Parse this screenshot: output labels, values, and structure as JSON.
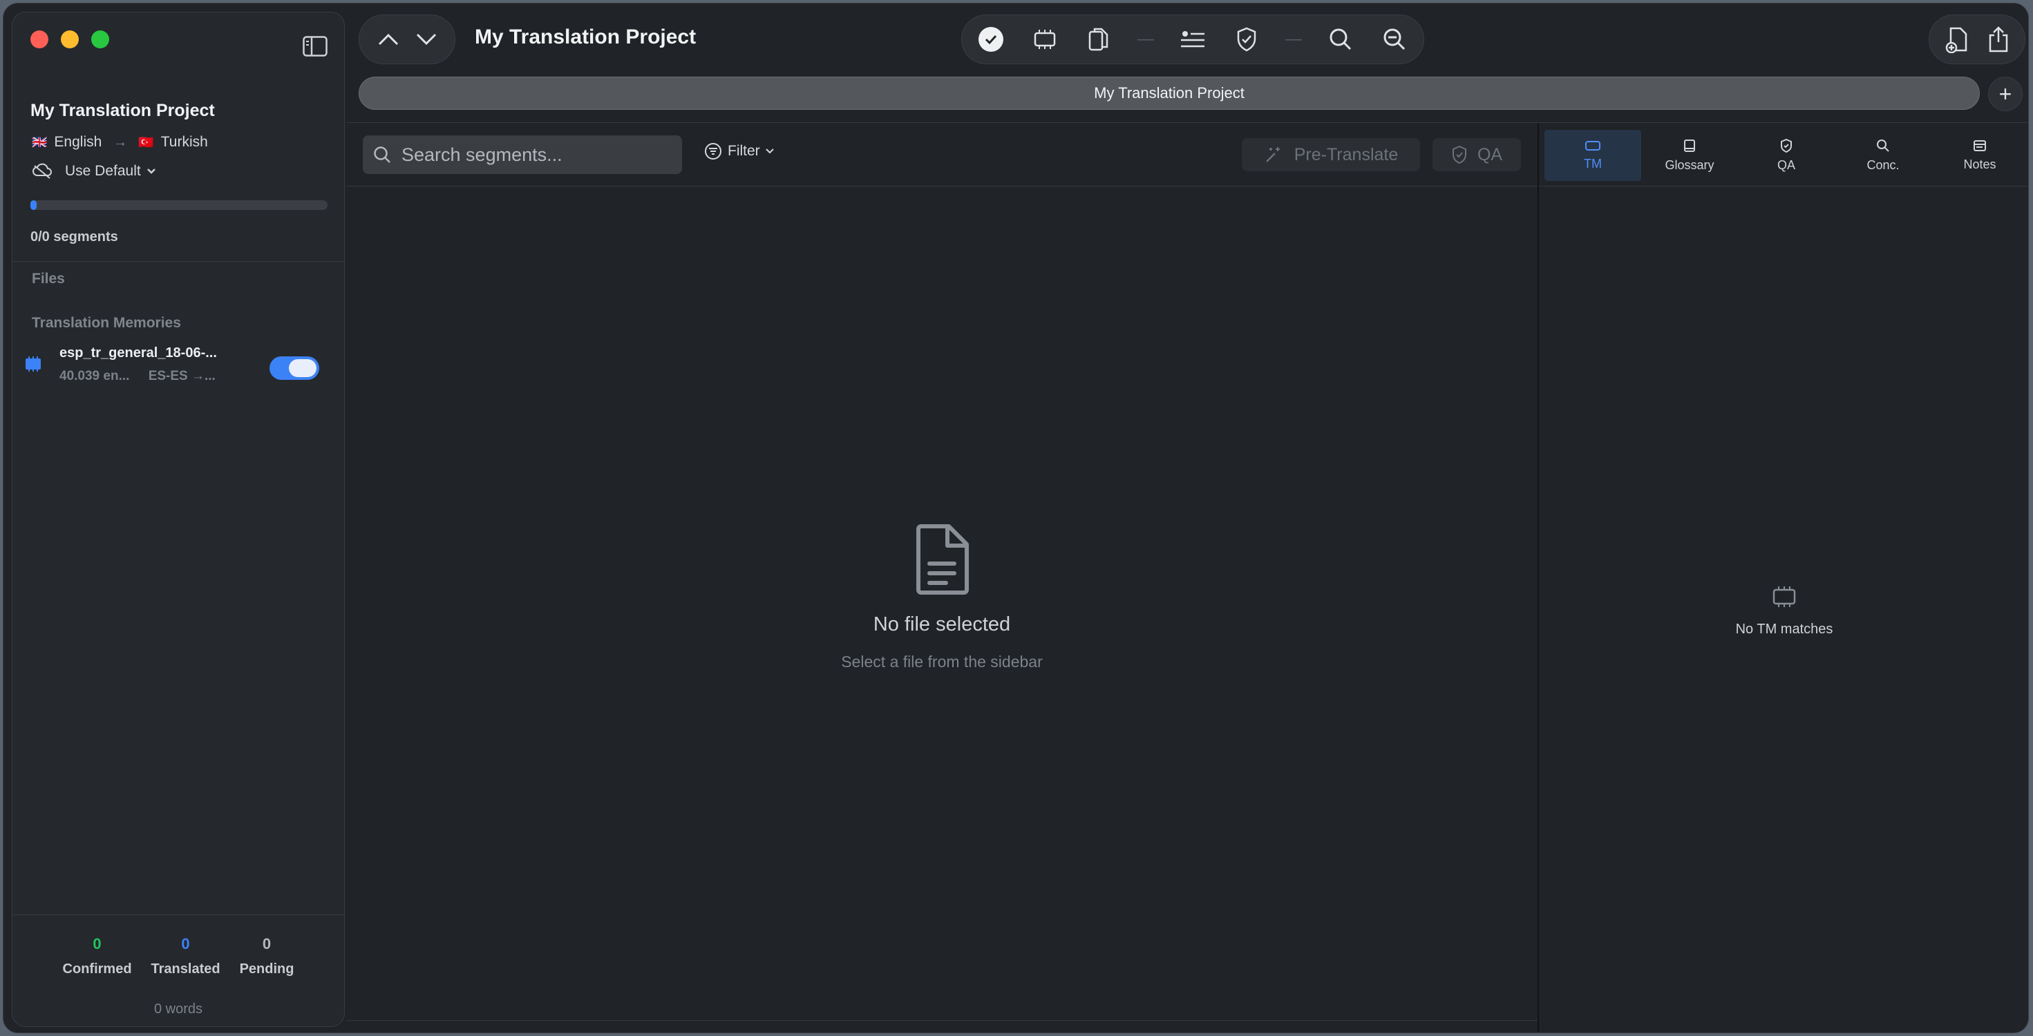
{
  "sidebar": {
    "project_title": "My Translation Project",
    "source_flag": "🇬🇧",
    "source_language": "English",
    "target_flag": "🇹🇷",
    "target_language": "Turkish",
    "default_label": "Use Default",
    "progress_fraction": 0.01,
    "segments_label": "0/0 segments",
    "files_header": "Files",
    "tm_header": "Translation Memories",
    "tm_items": [
      {
        "name": "esp_tr_general_18-06-...",
        "entries": "40.039 en...",
        "langs": "ES-ES →...",
        "enabled": true
      }
    ],
    "stats": {
      "confirmed_count": "0",
      "confirmed_label": "Confirmed",
      "translated_count": "0",
      "translated_label": "Translated",
      "pending_count": "0",
      "pending_label": "Pending"
    },
    "words_label": "0 words"
  },
  "toolbar": {
    "window_title": "My Translation Project",
    "icons": [
      "chevron-up-icon",
      "chevron-down-icon",
      "confirm-check-icon",
      "memory-chip-icon",
      "copy-source-icon",
      "separator",
      "segment-properties-icon",
      "shield-check-icon",
      "separator",
      "search-icon",
      "zoom-out-icon",
      "new-document-icon",
      "share-icon"
    ]
  },
  "tabbar": {
    "active_tab": "My Translation Project",
    "add_label": "+"
  },
  "editor": {
    "search_placeholder": "Search segments...",
    "filter_label": "Filter",
    "pretranslate_label": "Pre-Translate",
    "qa_label": "QA",
    "empty_title": "No file selected",
    "empty_subtitle": "Select a file from the sidebar"
  },
  "right_panel": {
    "tabs": [
      {
        "label": "TM",
        "icon": "tm-icon",
        "active": true
      },
      {
        "label": "Glossary",
        "icon": "book-icon",
        "active": false
      },
      {
        "label": "QA",
        "icon": "shield-check-icon",
        "active": false
      },
      {
        "label": "Conc.",
        "icon": "search-icon",
        "active": false
      },
      {
        "label": "Notes",
        "icon": "notes-icon",
        "active": false
      }
    ],
    "empty_label": "No TM matches"
  },
  "colors": {
    "accent": "#3b82f6",
    "confirmed": "#22c55e",
    "background": "#202327"
  }
}
